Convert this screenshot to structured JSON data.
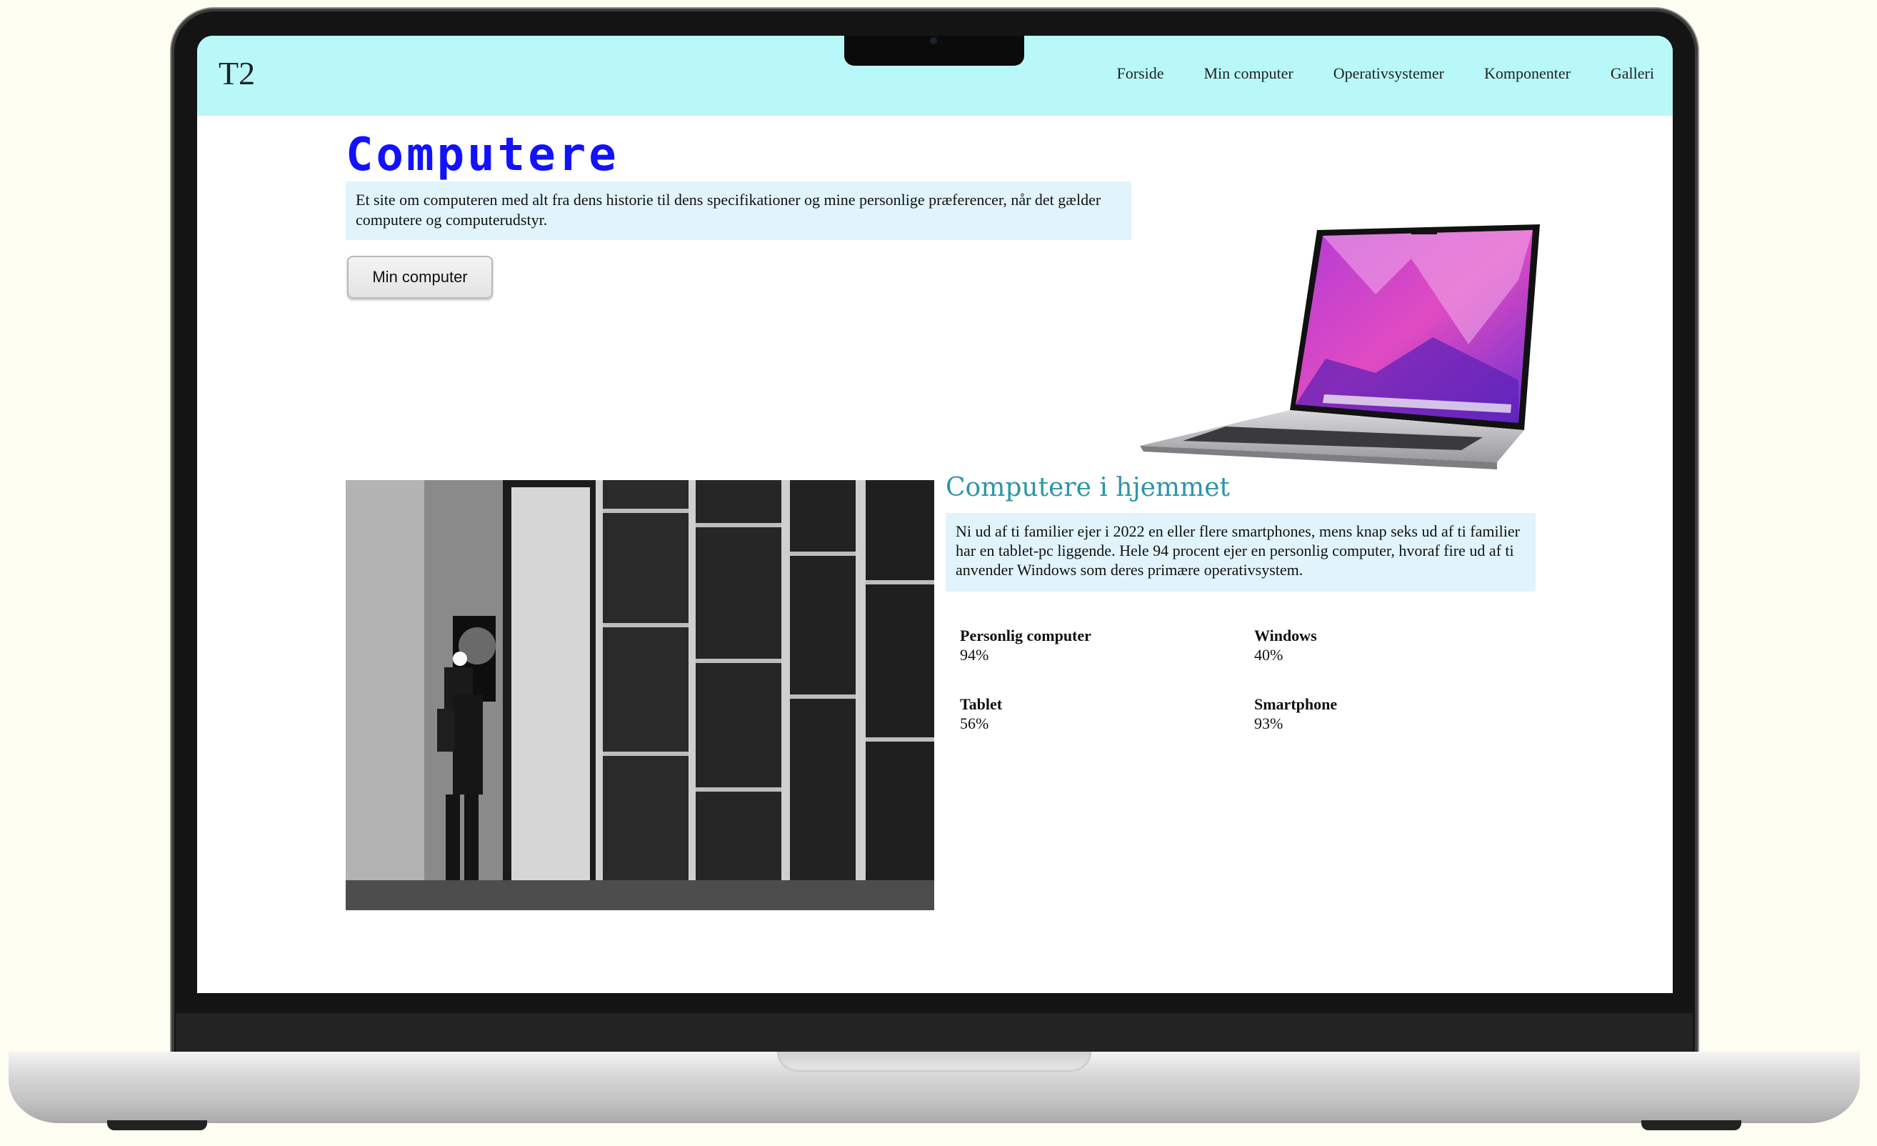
{
  "site": {
    "logo": "T2",
    "nav": [
      "Forside",
      "Min computer",
      "Operativsystemer",
      "Komponenter",
      "Galleri"
    ]
  },
  "hero": {
    "title": "Computere",
    "text": "Et site om computeren med alt fra dens historie til dens specifikationer og mine personlige præferencer, når det gælder computere og computerudstyr.",
    "button_label": "Min computer"
  },
  "home_section": {
    "title": "Computere i hjemmet",
    "text": "Ni ud af ti familier ejer i 2022 en eller flere smartphones, mens knap seks ud af ti familier har en tablet-pc liggende. Hele 94 procent ejer en personlig computer, hvoraf fire ud af ti anvender Windows som deres primære operativsystem.",
    "stats": [
      {
        "label": "Personlig computer",
        "value": "94%"
      },
      {
        "label": "Windows",
        "value": "40%"
      },
      {
        "label": "Tablet",
        "value": "56%"
      },
      {
        "label": "Smartphone",
        "value": "93%"
      }
    ]
  },
  "colors": {
    "header_bg": "#b8f8f9",
    "title_blue": "#1212ff",
    "section_title": "#2a96a6",
    "box_bg": "#e1f4fb"
  }
}
